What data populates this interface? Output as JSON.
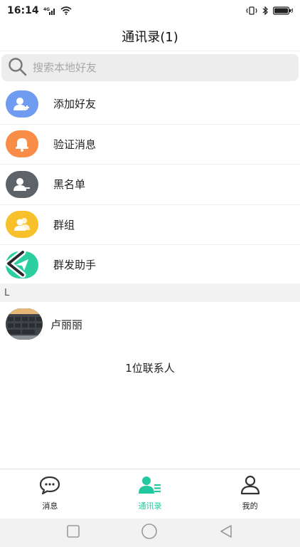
{
  "status_bar": {
    "time": "16:14",
    "signal_text": "4G"
  },
  "header": {
    "title": "通讯录(1)"
  },
  "search": {
    "placeholder": "搜索本地好友"
  },
  "menu": [
    {
      "label": "添加好友",
      "icon": "add-friend-icon",
      "color": "#6f9cf0"
    },
    {
      "label": "验证消息",
      "icon": "bell-icon",
      "color": "#f98c46"
    },
    {
      "label": "黑名单",
      "icon": "blacklist-icon",
      "color": "#5e6369"
    },
    {
      "label": "群组",
      "icon": "group-icon",
      "color": "#f8c02a"
    },
    {
      "label": "群发助手",
      "icon": "send-icon",
      "color": "#2bcfa0"
    }
  ],
  "section_letter": "L",
  "contacts": [
    {
      "name": "卢丽丽"
    }
  ],
  "contact_count": "1位联系人",
  "tabs": [
    {
      "label": "消息",
      "icon": "chat-bubble-icon",
      "active": false
    },
    {
      "label": "通讯录",
      "icon": "contacts-icon",
      "active": true
    },
    {
      "label": "我的",
      "icon": "profile-icon",
      "active": false
    }
  ],
  "colors": {
    "accent": "#21c9a0",
    "search_bg": "#ededed",
    "section_bg": "#f2f2f2"
  }
}
